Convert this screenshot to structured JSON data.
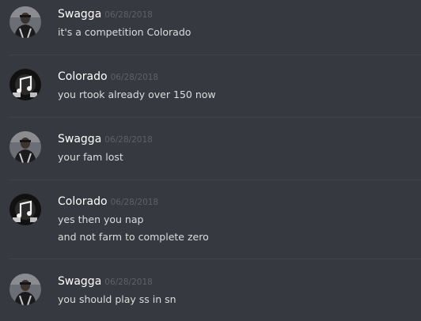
{
  "messages": [
    {
      "author": "Swagga",
      "avatar_icon": "swagga-avatar-icon",
      "timestamp": "06/28/2018",
      "lines": [
        "it's a competition Colorado"
      ]
    },
    {
      "author": "Colorado",
      "avatar_icon": "colorado-avatar-icon",
      "timestamp": "06/28/2018",
      "lines": [
        "you rtook already over 150 now"
      ]
    },
    {
      "author": "Swagga",
      "avatar_icon": "swagga-avatar-icon",
      "timestamp": "06/28/2018",
      "lines": [
        "your fam lost"
      ]
    },
    {
      "author": "Colorado",
      "avatar_icon": "colorado-avatar-icon",
      "timestamp": "06/28/2018",
      "lines": [
        "yes then you nap",
        "and not farm to complete zero"
      ]
    },
    {
      "author": "Swagga",
      "avatar_icon": "swagga-avatar-icon",
      "timestamp": "06/28/2018",
      "lines": [
        "you should play ss in sn"
      ]
    }
  ],
  "colors": {
    "background": "#36393f",
    "username": "#ffffff",
    "timestamp": "#5f6166",
    "message_text": "#dcddde",
    "divider": "#3f4248"
  }
}
